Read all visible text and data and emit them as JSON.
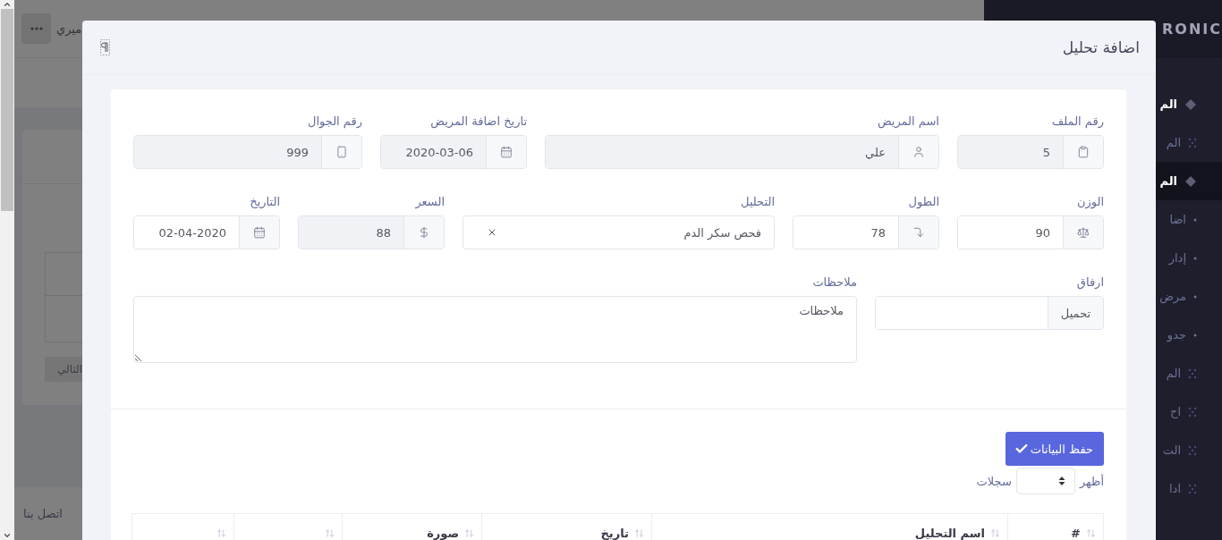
{
  "background_page": {
    "user_name": "ميري",
    "next_button": "التالي",
    "footer_link": "اتصل بنا"
  },
  "sidebar": {
    "logo": "RONIC",
    "items": [
      {
        "kind": "section",
        "label": "الم",
        "selected": false
      },
      {
        "kind": "item",
        "label": "الم",
        "selected": false
      },
      {
        "kind": "section",
        "label": "الم",
        "selected": true
      },
      {
        "kind": "sub",
        "label": "اضا",
        "selected": false
      },
      {
        "kind": "sub",
        "label": "إدار",
        "selected": false
      },
      {
        "kind": "sub",
        "label": "مرض",
        "selected": false
      },
      {
        "kind": "sub",
        "label": "جدو",
        "selected": false
      },
      {
        "kind": "item",
        "label": "الم",
        "selected": false
      },
      {
        "kind": "item",
        "label": "اح",
        "selected": false
      },
      {
        "kind": "item",
        "label": "الت",
        "selected": false
      },
      {
        "kind": "item",
        "label": "ادا",
        "selected": false
      }
    ]
  },
  "modal": {
    "title": "اضافة تحليل",
    "form_rows": [
      [
        {
          "kind": "text",
          "label": "رقم الملف",
          "value": "5",
          "readonly": true
        },
        {
          "kind": "text",
          "label": "اسم المريض",
          "value": "علي",
          "readonly": true
        },
        {
          "kind": "text",
          "label": "تاريخ اضافة المريض",
          "value": "2020-03-06",
          "readonly": true
        },
        {
          "kind": "text",
          "label": "رقم الجوال",
          "value": "999",
          "readonly": true
        }
      ],
      [
        {
          "kind": "text",
          "label": "الوزن",
          "value": "90",
          "readonly": false
        },
        {
          "kind": "text",
          "label": "الطول",
          "value": "78",
          "readonly": false
        },
        {
          "kind": "select",
          "label": "التحليل",
          "value": "فحص سكر الدم"
        },
        {
          "kind": "text",
          "label": "السعر",
          "value": "88",
          "readonly": true
        },
        {
          "kind": "text",
          "label": "التاريخ",
          "value": "02-04-2020",
          "readonly": false
        }
      ],
      [
        {
          "kind": "file",
          "label": "ارفاق",
          "button": "تحميل"
        },
        {
          "kind": "textarea",
          "label": "ملاحظات",
          "placeholder": "ملاحظات"
        }
      ]
    ],
    "save_button": "حفظ البيانات",
    "page_size": {
      "before": "أظهر",
      "after": "سجلات"
    },
    "table": {
      "columns": [
        {
          "label": "#",
          "sortable": true
        },
        {
          "label": "اسم التحليل",
          "sortable": true
        },
        {
          "label": "تاريخ",
          "sortable": true
        },
        {
          "label": "صورة",
          "sortable": true
        },
        {
          "sortable": true
        },
        {
          "sortable": true
        }
      ]
    }
  }
}
